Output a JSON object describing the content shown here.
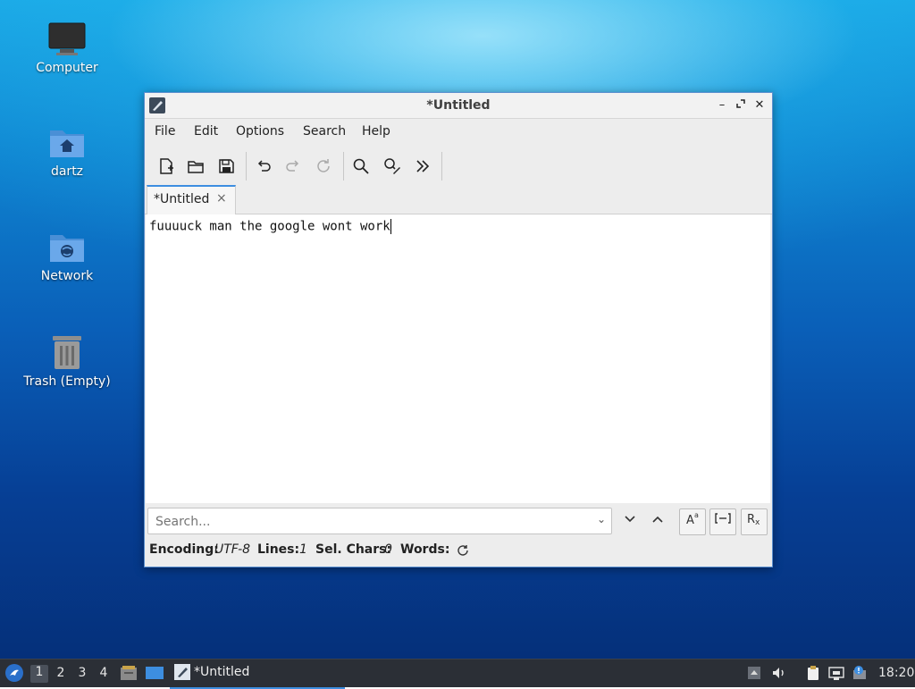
{
  "desktop": {
    "icons": [
      {
        "label": "Computer"
      },
      {
        "label": "dartz"
      },
      {
        "label": "Network"
      },
      {
        "label": "Trash (Empty)"
      }
    ]
  },
  "window": {
    "title": "*Untitled",
    "menu": [
      "File",
      "Edit",
      "Options",
      "Search",
      "Help"
    ],
    "toolbar": [
      "new-document",
      "open",
      "save",
      "undo",
      "redo",
      "reload",
      "find",
      "find-replace",
      "more"
    ],
    "tab_label": "*Untitled",
    "tab_close": "×",
    "editor_text": "fuuuuck man the google wont work",
    "search_placeholder": "Search...",
    "status": {
      "encoding_label": "Encoding:",
      "encoding_value": "UTF-8",
      "lines_label": "Lines:",
      "lines_value": "1",
      "selchars_label": "Sel. Chars:",
      "selchars_value": "0",
      "words_label": "Words:"
    }
  },
  "taskbar": {
    "workspaces": [
      "1",
      "2",
      "3",
      "4"
    ],
    "task_label": "*Untitled",
    "clock": "18:20"
  },
  "colors": {
    "accent": "#3d8ee0",
    "taskbar": "#2b2f36"
  }
}
